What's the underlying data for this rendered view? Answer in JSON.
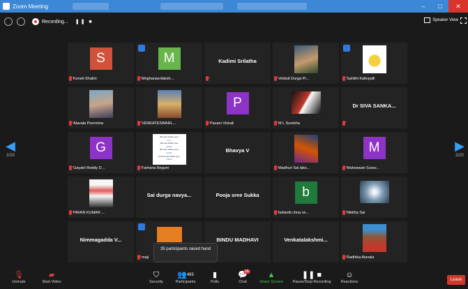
{
  "window": {
    "title": "Zoom Meeting"
  },
  "topbar": {
    "recording_label": "Recording...",
    "recording_controls": "❚❚ ■",
    "speaker_view_label": "Speaker View"
  },
  "pages": {
    "left": "2/20",
    "right": "2/20"
  },
  "tiles": [
    {
      "name": "Koneti Shalini",
      "letter": "S",
      "color": "#d2513b"
    },
    {
      "name": "Meghanasrilaksh...",
      "letter": "M",
      "color": "#68b54c"
    },
    {
      "big": "Kadimi Srilatha"
    },
    {
      "name": "Velduti Durga Pr..."
    },
    {
      "name": "Sahithi Kallepalli"
    },
    {
      "name": "Alavala Poornima"
    },
    {
      "name": "VENKATESWARL..."
    },
    {
      "name": "Pavani Vishali",
      "letter": "P",
      "color": "#8d33c6"
    },
    {
      "name": "M L Surekha"
    },
    {
      "big": "Dr SIVA SANKA..."
    },
    {
      "name": "Gayatri Reddy D...",
      "letter": "G",
      "color": "#8d33c6"
    },
    {
      "name": "Farhana Begum",
      "lines": [
        "We can reduce your",
        "form",
        "We can shrink your",
        "waters",
        "We can reduce your",
        "profits",
        "but they all notice your",
        "nobles"
      ]
    },
    {
      "big": "Bhavya V"
    },
    {
      "name": "Madhuri Sai laks..."
    },
    {
      "name": "Maheswari Surav...",
      "letter": "M",
      "color": "#8d33c6"
    },
    {
      "name": "PAVAN KUMAR ..."
    },
    {
      "big": "Sai  durga  navya..."
    },
    {
      "big": "Pooja sree Sukka"
    },
    {
      "name": "bolisetti chna ve...",
      "letter": "b",
      "color": "#1f7a3c"
    },
    {
      "name": "Nikitha Sai"
    },
    {
      "big": "Nimmagadda  V..."
    },
    {
      "name": "maji"
    },
    {
      "big": "BINDU MADHAVI"
    },
    {
      "big": "Venkatalakshmi..."
    },
    {
      "name": "Radhika Alavala"
    }
  ],
  "tooltip": {
    "text": "35 participants raised hand"
  },
  "toolbar": {
    "unmute": "Unmute",
    "start_video": "Start Video",
    "security": "Security",
    "participants": "Participants",
    "participants_count": "493",
    "polls": "Polls",
    "chat": "Chat",
    "chat_badge": "16",
    "share_screen": "Share Screen",
    "pause_recording": "Pause/Stop Recording",
    "reactions": "Reactions",
    "leave": "Leave"
  }
}
